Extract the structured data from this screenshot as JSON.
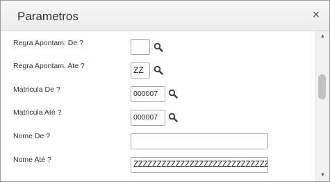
{
  "dialog": {
    "title": "Parametros",
    "close_label": "×"
  },
  "fields": [
    {
      "label": "Regra Apontam. De ?",
      "value": "",
      "has_search": true
    },
    {
      "label": "Regra Apontam. Ate ?",
      "value": "ZZ",
      "has_search": true
    },
    {
      "label": "Matricula De ?",
      "value": "000007",
      "has_search": true
    },
    {
      "label": "Matricula Até ?",
      "value": "000007",
      "has_search": true
    },
    {
      "label": "Nome De ?",
      "value": "",
      "has_search": false
    },
    {
      "label": "Nome Até ?",
      "value": "ZZZZZZZZZZZZZZZZZZZZZZZZZZZZZZ",
      "has_search": false
    }
  ],
  "scrollbar": {
    "up_arrow": "▲",
    "down_arrow": "▼"
  },
  "icons": {
    "search": "search-icon",
    "close": "close-icon"
  }
}
